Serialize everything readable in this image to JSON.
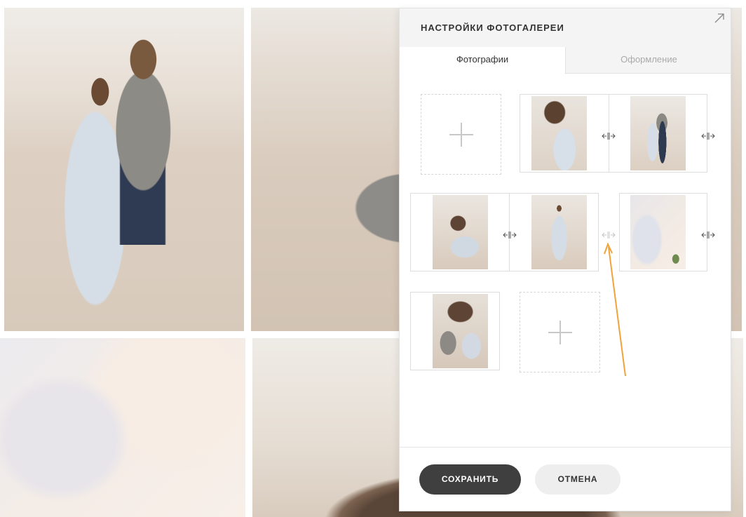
{
  "gallery": {
    "photos": [
      {
        "icon": "couple-standing-photo"
      },
      {
        "icon": "couple-lying-photo"
      },
      {
        "icon": "dress-detail-photo"
      },
      {
        "icon": "hair-closeup-photo"
      }
    ]
  },
  "panel": {
    "title": "НАСТРОЙКИ ФОТОГАЛЕРЕИ",
    "expand_icon": "expand-arrow-icon",
    "tabs": [
      {
        "label": "Фотографии",
        "active": true
      },
      {
        "label": "Оформление",
        "active": false
      }
    ],
    "rows": [
      {
        "items": [
          "add",
          "photo-wind-hair",
          "photo-couple-standing"
        ]
      },
      {
        "items": [
          "photo-couple-lying",
          "photo-bride-standing",
          "photo-dress-bouquet"
        ]
      },
      {
        "items": [
          "photo-couple-kiss",
          "add"
        ]
      }
    ],
    "resize_icon": "resize-horizontal-icon",
    "add_icon": "plus-icon"
  },
  "footer": {
    "save_label": "СОХРАНИТЬ",
    "cancel_label": "ОТМЕНА"
  },
  "colors": {
    "accent_arrow": "#f0a33a",
    "save_button": "#3f3f3f",
    "cancel_button": "#eeeeee"
  }
}
